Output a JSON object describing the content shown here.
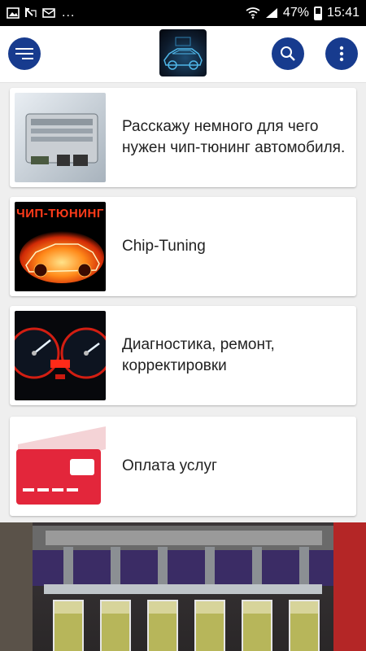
{
  "status_bar": {
    "battery": "47%",
    "time": "15:41",
    "more": "...",
    "icons": [
      "image-icon",
      "missed-call-icon",
      "mail-icon",
      "wifi-icon",
      "signal-icon",
      "battery-icon"
    ]
  },
  "app_bar": {
    "menu_icon": "menu-icon",
    "logo": "car-logo",
    "search_icon": "search-icon",
    "more_icon": "more-vertical-icon"
  },
  "items": [
    {
      "title": "Расскажу немного для чего нужен чип-тюнинг автомобиля.",
      "thumb": "ecu-module"
    },
    {
      "title": "Chip-Tuning",
      "thumb_caption": "ЧИП-ТЮНИНГ",
      "thumb": "flaming-car"
    },
    {
      "title": "Диагностика, ремонт, корректировки",
      "thumb": "dashboard-gauges"
    },
    {
      "title": "Оплата услуг",
      "thumb": "credit-card"
    }
  ],
  "colors": {
    "accent": "#173b8e",
    "background": "#efefef",
    "card": "#ffffff",
    "card_red": "#e3263b"
  }
}
